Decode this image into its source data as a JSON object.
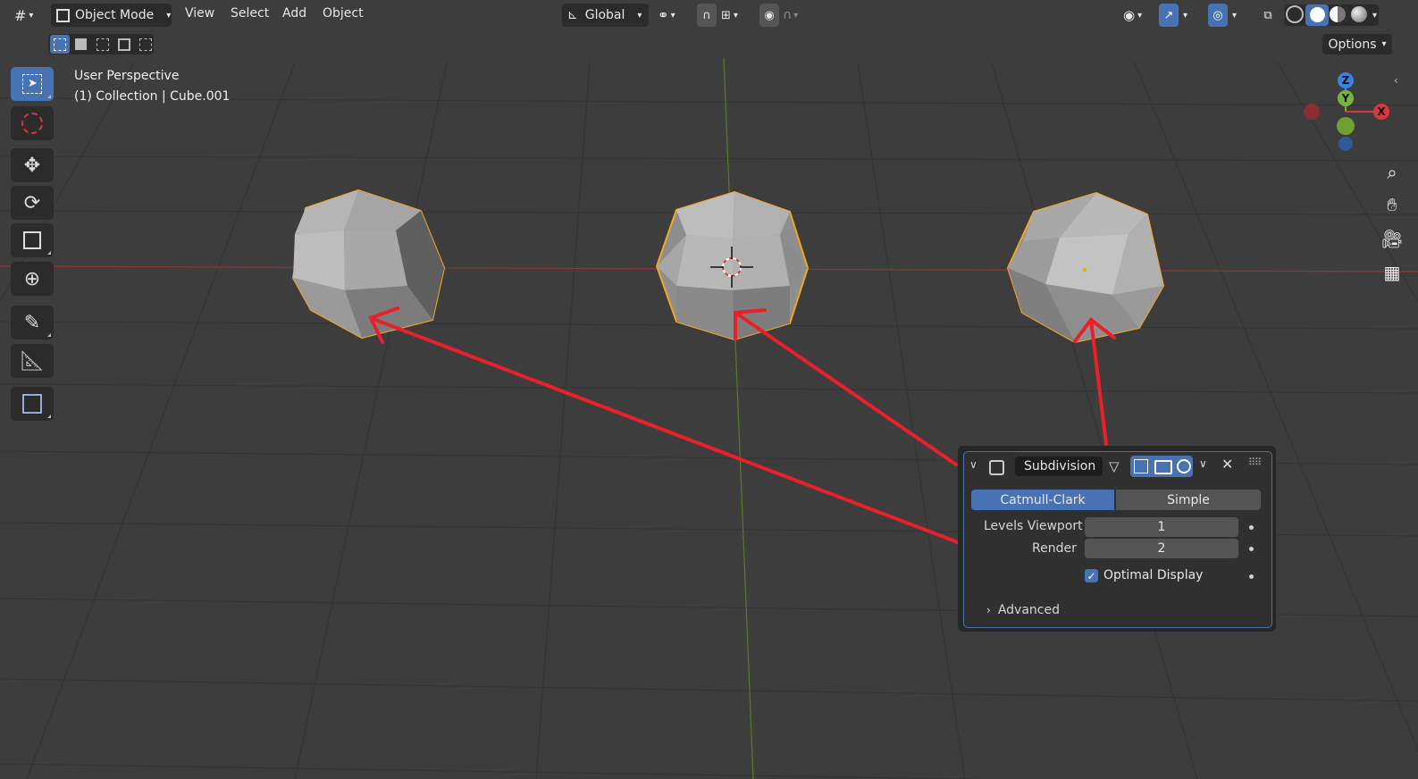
{
  "header": {
    "editor_type_icon": "grid-editor-icon",
    "mode_label": "Object Mode",
    "menus": [
      "View",
      "Select",
      "Add",
      "Object"
    ],
    "orientation_label": "Global",
    "options_label": "Options"
  },
  "viewport": {
    "perspective_label": "User Perspective",
    "collection_label": "(1) Collection | Cube.001",
    "gizmo": {
      "z": "Z",
      "y": "Y",
      "x": "X"
    }
  },
  "modifier": {
    "name": "Subdivision",
    "algorithms": [
      "Catmull-Clark",
      "Simple"
    ],
    "selected_algorithm": "Catmull-Clark",
    "levels_viewport_label": "Levels Viewport",
    "levels_viewport_value": "1",
    "render_label": "Render",
    "render_value": "2",
    "optimal_display_label": "Optimal Display",
    "optimal_display_checked": true,
    "advanced_label": "Advanced"
  },
  "colors": {
    "background": "#3d3d3d",
    "accent": "#4772b3",
    "selection_outline": "#f5a623",
    "annotation_arrow": "#e8202a",
    "axis_x": "#d9363e",
    "axis_y": "#7ab33a",
    "axis_z": "#3b82e0"
  }
}
